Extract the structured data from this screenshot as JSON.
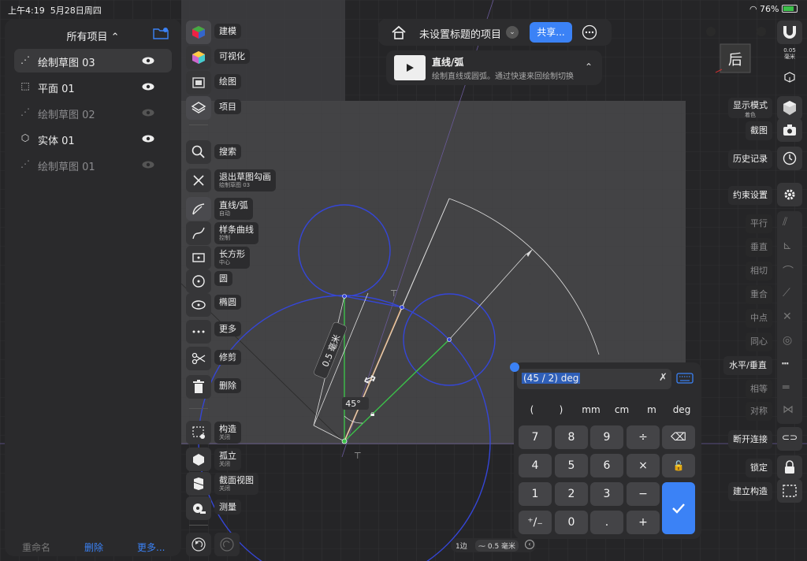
{
  "status_bar": {
    "time": "上午4:19",
    "date": "5月28日周四",
    "battery": "76%"
  },
  "browser": {
    "title": "所有项目",
    "items": [
      {
        "label": "绘制草图 03",
        "icon": "sketch-icon",
        "selected": true,
        "visible": true
      },
      {
        "label": "平面  01",
        "icon": "plane-icon",
        "selected": false,
        "visible": true
      },
      {
        "label": "绘制草图 02",
        "icon": "sketch-icon",
        "selected": false,
        "visible": false
      },
      {
        "label": "实体  01",
        "icon": "cube-icon",
        "selected": false,
        "visible": true
      },
      {
        "label": "绘制草图 01",
        "icon": "sketch-icon",
        "selected": false,
        "visible": false
      }
    ],
    "rename": "重命名",
    "delete": "删除",
    "more": "更多..."
  },
  "tools": {
    "modeling": "建模",
    "visualize": "可视化",
    "drawing": "绘图",
    "project": "项目",
    "search": "搜索",
    "exit_sketch": "退出草图勾画",
    "exit_sketch_sub": "绘制草图 03",
    "line_arc": "直线/弧",
    "line_arc_sub": "自动",
    "spline": "样条曲线",
    "spline_sub": "控制",
    "rectangle": "长方形",
    "rectangle_sub": "中心",
    "circle": "圆",
    "ellipse": "椭圆",
    "more": "更多",
    "trim": "修剪",
    "delete": "删除",
    "construct": "构造",
    "construct_sub": "关闭",
    "isolate": "孤立",
    "isolate_sub": "关闭",
    "section_view": "截面视图",
    "section_view_sub": "关闭",
    "measure": "测量"
  },
  "header": {
    "project_title": "未设置标题的项目",
    "share": "共享..."
  },
  "tutorial": {
    "title": "直线/弧",
    "desc": "绘制直线或圆弧。通过快速来回绘制切换"
  },
  "right_panel": {
    "unit_value": "0.05",
    "unit_name": "毫米",
    "view_cube": "后",
    "display_mode": "显示模式",
    "display_mode_sub": "着色",
    "screenshot": "截图",
    "history": "历史记录",
    "constraint_settings": "约束设置",
    "parallel": "平行",
    "perpendicular": "垂直",
    "tangent": "相切",
    "coincident": "重合",
    "midpoint": "中点",
    "concentric": "同心",
    "horizontal_vertical": "水平/垂直",
    "equal": "相等",
    "symmetric": "对称",
    "disconnect": "断开连接",
    "lock": "锁定",
    "make_construction": "建立构造"
  },
  "dimensions": {
    "length": "0.5 毫米",
    "angle": "45°"
  },
  "keypad": {
    "expression": "(45 / 2) deg",
    "units": [
      "(",
      ")",
      "mm",
      "cm",
      "m",
      "deg"
    ],
    "keys": [
      "7",
      "8",
      "9",
      "÷",
      "⌫",
      "4",
      "5",
      "6",
      "×",
      "🔓",
      "1",
      "2",
      "3",
      "−",
      "⁺∕₋",
      "0",
      ".",
      "+"
    ]
  },
  "footer": {
    "edge_count": "1边",
    "snap": "0.5 毫米"
  },
  "colors": {
    "accent": "#3b82f6",
    "sketch_blue": "#3546d8",
    "construction_green": "#3cc04a",
    "selected_orange": "#e0a060"
  }
}
